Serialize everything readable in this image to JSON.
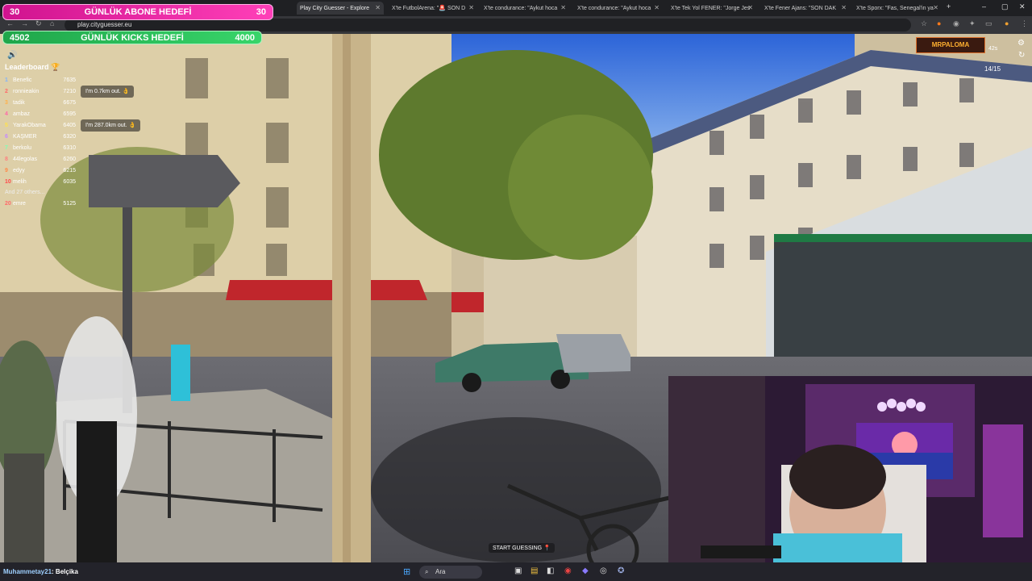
{
  "browser": {
    "tabs": [
      {
        "label": "Play City Guesser - Explore",
        "active": true
      },
      {
        "label": "X'te FutbolArena: \"🚨 SON D"
      },
      {
        "label": "X'te condurance: \"Aykut hoca"
      },
      {
        "label": "X'te condurance: \"Aykut hoca"
      },
      {
        "label": "X'te Tek Yol FENER: \"Jorge Jes"
      },
      {
        "label": "X'te Fener Ajans: \"SON DAK"
      },
      {
        "label": "X'te Sporx: \"Fas, Senegal'in ya"
      }
    ],
    "url": "play.cityguesser.eu"
  },
  "goals": {
    "sub": {
      "left": "30",
      "label": "GÜNLÜK ABONE HEDEFİ",
      "right": "30"
    },
    "kicks": {
      "left": "4502",
      "label": "GÜNLÜK KICKS HEDEFİ",
      "right": "4000"
    }
  },
  "leaderboard": {
    "title": "Leaderboard",
    "rows": [
      {
        "rank": "1",
        "name": "Benefic",
        "points": "7635"
      },
      {
        "rank": "2",
        "name": "ronnieakin",
        "points": "7210"
      },
      {
        "rank": "3",
        "name": "tadik",
        "points": "6675"
      },
      {
        "rank": "4",
        "name": "ambaz",
        "points": "6595"
      },
      {
        "rank": "5",
        "name": "YarakObama",
        "points": "6405"
      },
      {
        "rank": "6",
        "name": "KAŞMER",
        "points": "6320"
      },
      {
        "rank": "7",
        "name": "berkolu",
        "points": "6310"
      },
      {
        "rank": "8",
        "name": "44legolas",
        "points": "6260"
      },
      {
        "rank": "9",
        "name": "edyy",
        "points": "6215"
      },
      {
        "rank": "10",
        "name": "melih",
        "points": "6035"
      }
    ],
    "more": "And 27 others...",
    "self": {
      "rank": "20",
      "name": "emre",
      "points": "5125"
    }
  },
  "bubbles": [
    "I'm 0.7km out. 👌",
    "I'm 287.0km out. 👌"
  ],
  "status": {
    "timer": "42s",
    "round": "14/15",
    "watermark": "MRPALOMA"
  },
  "start_label": "START GUESSING",
  "chat": {
    "user": "Muhammetay21",
    "message": "Belçika"
  },
  "taskbar": {
    "search": "Ara"
  }
}
